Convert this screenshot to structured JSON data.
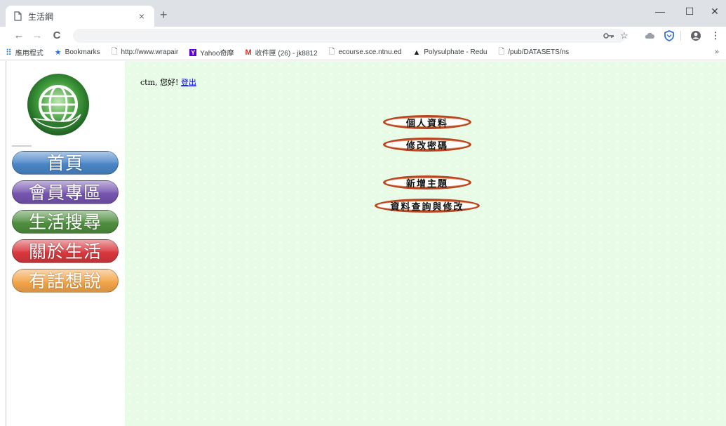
{
  "browser": {
    "tab_title": "生活網",
    "tab_close": "×",
    "new_tab": "+",
    "window_controls": {
      "minimize": "—",
      "maximize": "☐",
      "close": "✕"
    },
    "nav": {
      "back": "←",
      "forward": "→",
      "reload": "C"
    },
    "toolbar_icons": [
      "key-icon",
      "star-icon",
      "cloud-icon",
      "shield-icon",
      "account-icon",
      "menu-icon"
    ],
    "bookmarks": [
      {
        "label": "應用程式",
        "icon": "apps-grid-icon"
      },
      {
        "label": "Bookmarks",
        "icon": "star-icon"
      },
      {
        "label": "http://www.wrapair",
        "icon": "page-icon"
      },
      {
        "label": "Yahoo奇摩",
        "icon": "yahoo-icon"
      },
      {
        "label": "收件匣 (26) - jk8812",
        "icon": "gmail-icon"
      },
      {
        "label": "ecourse.sce.ntnu.ed",
        "icon": "page-icon"
      },
      {
        "label": "Polysulphate - Redu",
        "icon": "triangle-logo-icon"
      },
      {
        "label": "/pub/DATASETS/ns",
        "icon": "page-icon"
      }
    ],
    "bookmarks_more": "»"
  },
  "sidebar": {
    "logo": "globe-in-hand-logo",
    "nav_items": [
      {
        "label": "首頁",
        "color": "#4a86c8"
      },
      {
        "label": "會員專區",
        "color": "#7655b0"
      },
      {
        "label": "生活搜尋",
        "color": "#4e8f3e"
      },
      {
        "label": "關於生活",
        "color": "#d9383e"
      },
      {
        "label": "有話想說",
        "color": "#f4a54a"
      }
    ]
  },
  "main": {
    "greeting_prefix": "ctm, 您好! ",
    "logout_link": "登出",
    "buttons": {
      "profile": "個人資料",
      "change_password": "修改密碼",
      "add_topic": "新增主題",
      "query_edit": "資料查詢與修改"
    }
  },
  "colors": {
    "page_background": "#e8fbe6",
    "button_border": "#b8451f"
  }
}
